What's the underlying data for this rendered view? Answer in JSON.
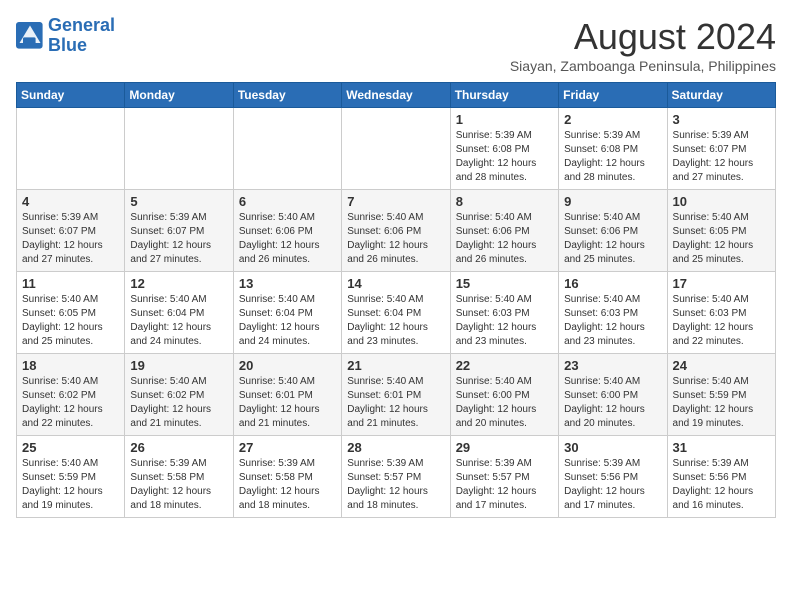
{
  "logo": {
    "line1": "General",
    "line2": "Blue"
  },
  "title": "August 2024",
  "subtitle": "Siayan, Zamboanga Peninsula, Philippines",
  "weekdays": [
    "Sunday",
    "Monday",
    "Tuesday",
    "Wednesday",
    "Thursday",
    "Friday",
    "Saturday"
  ],
  "weeks": [
    [
      {
        "day": "",
        "info": ""
      },
      {
        "day": "",
        "info": ""
      },
      {
        "day": "",
        "info": ""
      },
      {
        "day": "",
        "info": ""
      },
      {
        "day": "1",
        "info": "Sunrise: 5:39 AM\nSunset: 6:08 PM\nDaylight: 12 hours\nand 28 minutes."
      },
      {
        "day": "2",
        "info": "Sunrise: 5:39 AM\nSunset: 6:08 PM\nDaylight: 12 hours\nand 28 minutes."
      },
      {
        "day": "3",
        "info": "Sunrise: 5:39 AM\nSunset: 6:07 PM\nDaylight: 12 hours\nand 27 minutes."
      }
    ],
    [
      {
        "day": "4",
        "info": "Sunrise: 5:39 AM\nSunset: 6:07 PM\nDaylight: 12 hours\nand 27 minutes."
      },
      {
        "day": "5",
        "info": "Sunrise: 5:39 AM\nSunset: 6:07 PM\nDaylight: 12 hours\nand 27 minutes."
      },
      {
        "day": "6",
        "info": "Sunrise: 5:40 AM\nSunset: 6:06 PM\nDaylight: 12 hours\nand 26 minutes."
      },
      {
        "day": "7",
        "info": "Sunrise: 5:40 AM\nSunset: 6:06 PM\nDaylight: 12 hours\nand 26 minutes."
      },
      {
        "day": "8",
        "info": "Sunrise: 5:40 AM\nSunset: 6:06 PM\nDaylight: 12 hours\nand 26 minutes."
      },
      {
        "day": "9",
        "info": "Sunrise: 5:40 AM\nSunset: 6:06 PM\nDaylight: 12 hours\nand 25 minutes."
      },
      {
        "day": "10",
        "info": "Sunrise: 5:40 AM\nSunset: 6:05 PM\nDaylight: 12 hours\nand 25 minutes."
      }
    ],
    [
      {
        "day": "11",
        "info": "Sunrise: 5:40 AM\nSunset: 6:05 PM\nDaylight: 12 hours\nand 25 minutes."
      },
      {
        "day": "12",
        "info": "Sunrise: 5:40 AM\nSunset: 6:04 PM\nDaylight: 12 hours\nand 24 minutes."
      },
      {
        "day": "13",
        "info": "Sunrise: 5:40 AM\nSunset: 6:04 PM\nDaylight: 12 hours\nand 24 minutes."
      },
      {
        "day": "14",
        "info": "Sunrise: 5:40 AM\nSunset: 6:04 PM\nDaylight: 12 hours\nand 23 minutes."
      },
      {
        "day": "15",
        "info": "Sunrise: 5:40 AM\nSunset: 6:03 PM\nDaylight: 12 hours\nand 23 minutes."
      },
      {
        "day": "16",
        "info": "Sunrise: 5:40 AM\nSunset: 6:03 PM\nDaylight: 12 hours\nand 23 minutes."
      },
      {
        "day": "17",
        "info": "Sunrise: 5:40 AM\nSunset: 6:03 PM\nDaylight: 12 hours\nand 22 minutes."
      }
    ],
    [
      {
        "day": "18",
        "info": "Sunrise: 5:40 AM\nSunset: 6:02 PM\nDaylight: 12 hours\nand 22 minutes."
      },
      {
        "day": "19",
        "info": "Sunrise: 5:40 AM\nSunset: 6:02 PM\nDaylight: 12 hours\nand 21 minutes."
      },
      {
        "day": "20",
        "info": "Sunrise: 5:40 AM\nSunset: 6:01 PM\nDaylight: 12 hours\nand 21 minutes."
      },
      {
        "day": "21",
        "info": "Sunrise: 5:40 AM\nSunset: 6:01 PM\nDaylight: 12 hours\nand 21 minutes."
      },
      {
        "day": "22",
        "info": "Sunrise: 5:40 AM\nSunset: 6:00 PM\nDaylight: 12 hours\nand 20 minutes."
      },
      {
        "day": "23",
        "info": "Sunrise: 5:40 AM\nSunset: 6:00 PM\nDaylight: 12 hours\nand 20 minutes."
      },
      {
        "day": "24",
        "info": "Sunrise: 5:40 AM\nSunset: 5:59 PM\nDaylight: 12 hours\nand 19 minutes."
      }
    ],
    [
      {
        "day": "25",
        "info": "Sunrise: 5:40 AM\nSunset: 5:59 PM\nDaylight: 12 hours\nand 19 minutes."
      },
      {
        "day": "26",
        "info": "Sunrise: 5:39 AM\nSunset: 5:58 PM\nDaylight: 12 hours\nand 18 minutes."
      },
      {
        "day": "27",
        "info": "Sunrise: 5:39 AM\nSunset: 5:58 PM\nDaylight: 12 hours\nand 18 minutes."
      },
      {
        "day": "28",
        "info": "Sunrise: 5:39 AM\nSunset: 5:57 PM\nDaylight: 12 hours\nand 18 minutes."
      },
      {
        "day": "29",
        "info": "Sunrise: 5:39 AM\nSunset: 5:57 PM\nDaylight: 12 hours\nand 17 minutes."
      },
      {
        "day": "30",
        "info": "Sunrise: 5:39 AM\nSunset: 5:56 PM\nDaylight: 12 hours\nand 17 minutes."
      },
      {
        "day": "31",
        "info": "Sunrise: 5:39 AM\nSunset: 5:56 PM\nDaylight: 12 hours\nand 16 minutes."
      }
    ]
  ]
}
